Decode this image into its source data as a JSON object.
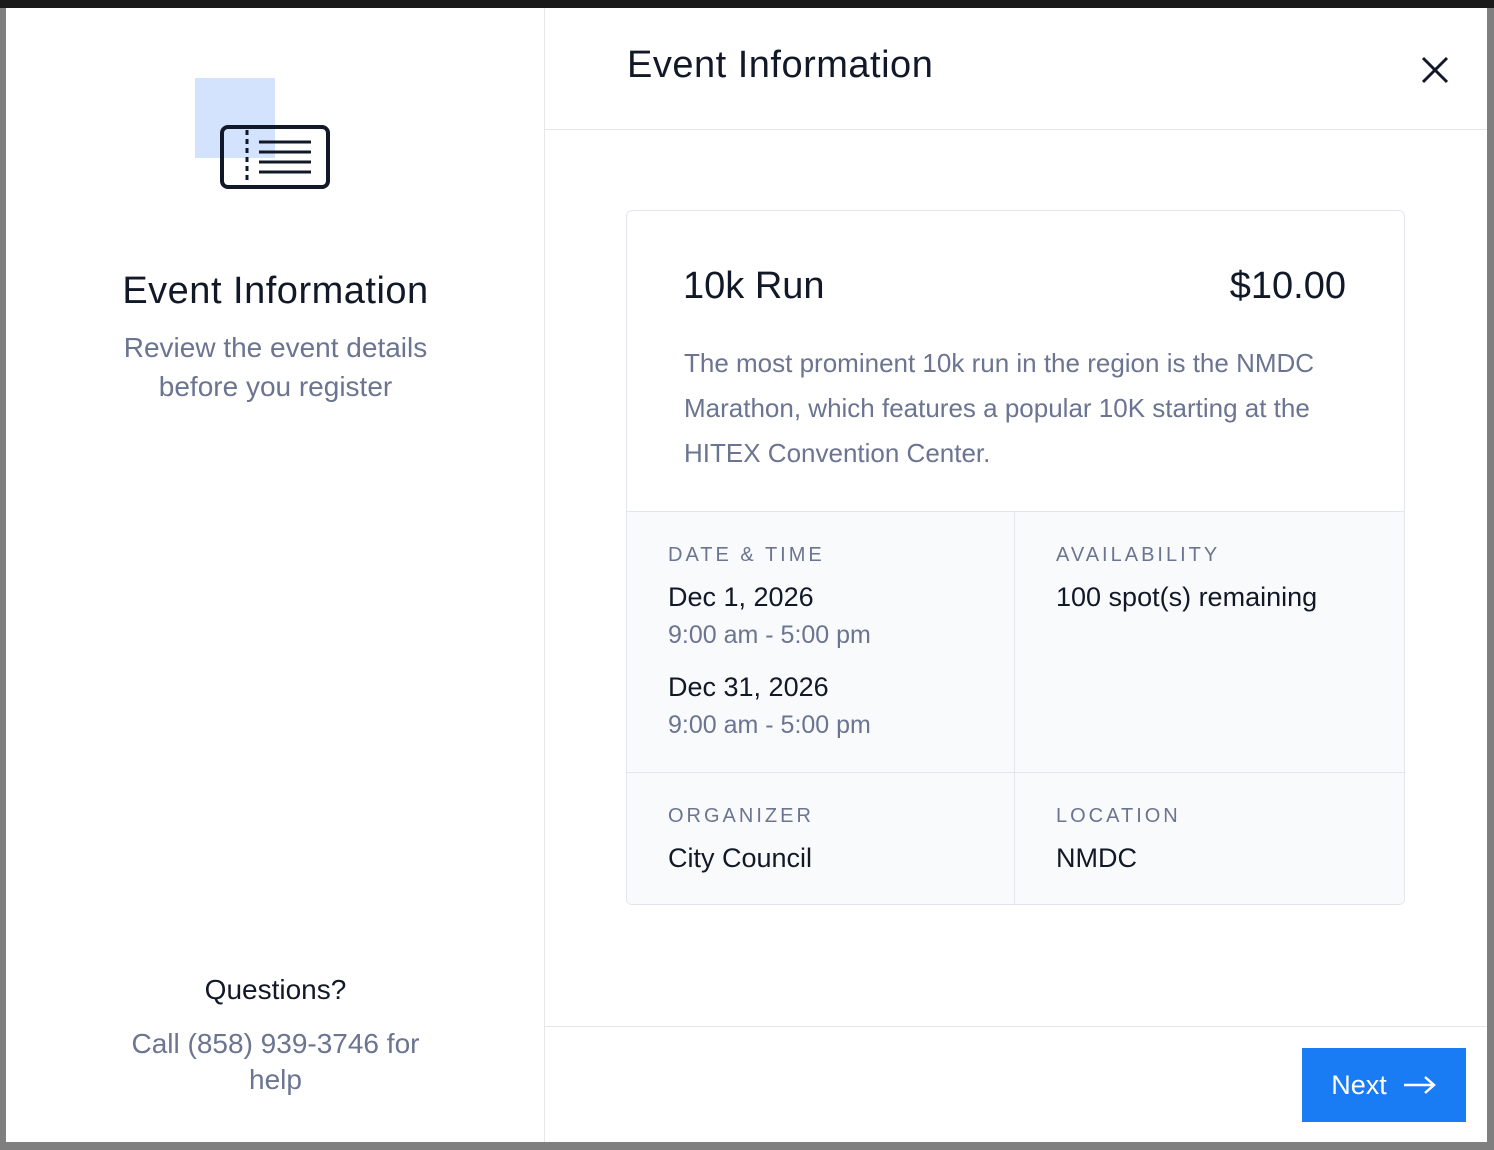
{
  "left_panel": {
    "icon": "ticket-icon",
    "title": "Event Information",
    "subtitle": "Review the event details before you register",
    "questions_title": "Questions?",
    "questions_text": "Call (858) 939-3746 for help"
  },
  "header": {
    "title": "Event Information",
    "close_icon": "close-icon"
  },
  "event": {
    "name": "10k Run",
    "price": "$10.00",
    "description": "The most prominent 10k run in the region is the NMDC Marathon, which features a popular 10K starting at the HITEX Convention Center.",
    "date_time_label": "DATE & TIME",
    "dates": [
      {
        "date": "Dec 1, 2026",
        "time": "9:00 am - 5:00 pm"
      },
      {
        "date": "Dec 31, 2026",
        "time": "9:00 am - 5:00 pm"
      }
    ],
    "availability_label": "AVAILABILITY",
    "availability_value": "100 spot(s) remaining",
    "organizer_label": "ORGANIZER",
    "organizer_value": "City Council",
    "location_label": "LOCATION",
    "location_value": "NMDC"
  },
  "footer": {
    "next_label": "Next",
    "next_icon": "arrow-right-icon",
    "accent_color": "#1a7cf5"
  }
}
